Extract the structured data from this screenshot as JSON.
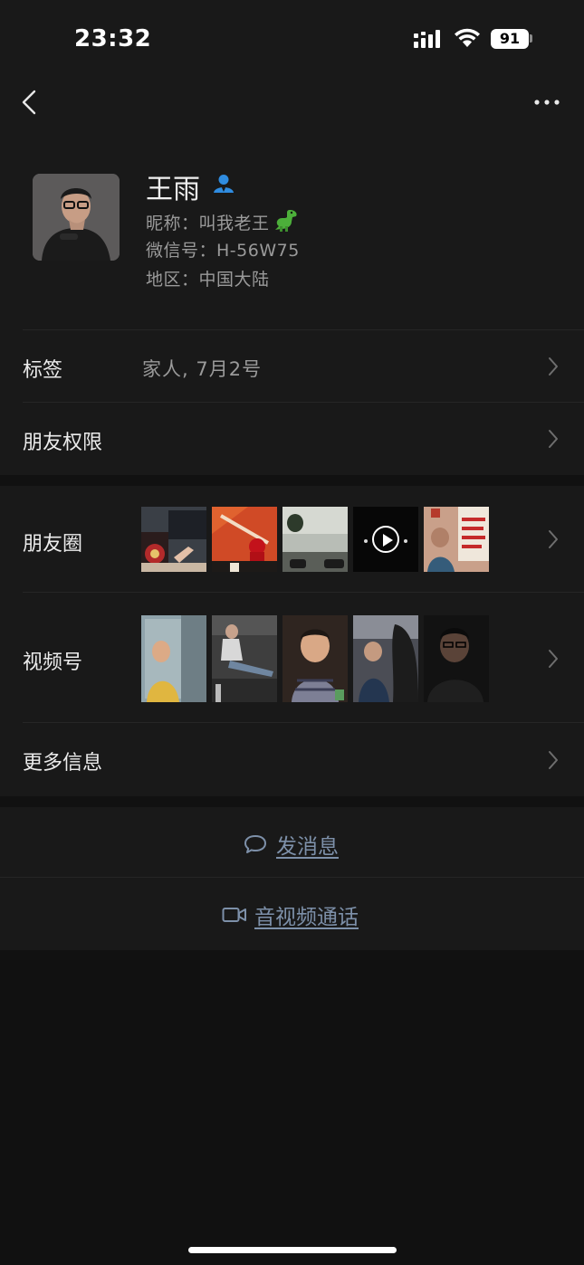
{
  "status_bar": {
    "time": "23:32",
    "battery": "91"
  },
  "profile": {
    "name": "王雨",
    "nickname": "昵称：叫我老王",
    "wechat_id": "微信号：H-56W75",
    "region": "地区：中国大陆"
  },
  "tags_row": {
    "label": "标签",
    "value": "家人, 7月2号"
  },
  "permissions_row": {
    "label": "朋友权限"
  },
  "moments_row": {
    "label": "朋友圈"
  },
  "channels_row": {
    "label": "视频号"
  },
  "more_info_row": {
    "label": "更多信息"
  },
  "actions": {
    "message": "发消息",
    "call": "音视频通话"
  },
  "colors": {
    "background": "#111111",
    "card": "#191919",
    "link": "#7d90a9",
    "verified": "#2f8ce0"
  }
}
